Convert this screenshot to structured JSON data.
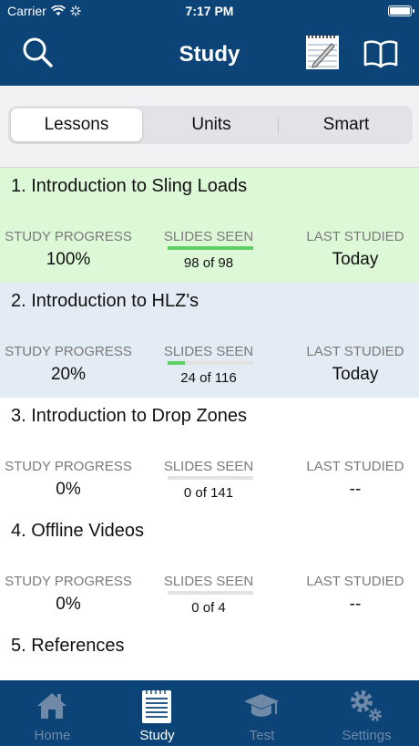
{
  "status_bar": {
    "carrier": "Carrier",
    "time": "7:17 PM"
  },
  "nav": {
    "title": "Study",
    "left_icon": "search-icon",
    "right_icons": [
      "notes-icon",
      "book-icon"
    ]
  },
  "segments": [
    {
      "label": "Lessons",
      "selected": true
    },
    {
      "label": "Units",
      "selected": false
    },
    {
      "label": "Smart",
      "selected": false
    }
  ],
  "labels": {
    "progress": "STUDY PROGRESS",
    "seen": "SLIDES SEEN",
    "last": "LAST STUDIED"
  },
  "lessons": [
    {
      "title": "1. Introduction to Sling Loads",
      "progress": "100%",
      "seen": "98 of 98",
      "seen_fraction": 1.0,
      "last": "Today",
      "bg": "#dcf8d6"
    },
    {
      "title": "2. Introduction to HLZ's",
      "progress": "20%",
      "seen": "24 of 116",
      "seen_fraction": 0.2,
      "last": "Today",
      "bg": "#e3ebf4"
    },
    {
      "title": "3. Introduction to Drop Zones",
      "progress": "0%",
      "seen": "0 of 141",
      "seen_fraction": 0,
      "last": "--",
      "bg": "#ffffff"
    },
    {
      "title": "4. Offline Videos",
      "progress": "0%",
      "seen": "0 of 4",
      "seen_fraction": 0,
      "last": "--",
      "bg": "#ffffff"
    },
    {
      "title": "5. References",
      "bg": "#ffffff"
    }
  ],
  "tabs": [
    {
      "label": "Home",
      "icon": "home-icon",
      "active": false
    },
    {
      "label": "Study",
      "icon": "notepad-icon",
      "active": true
    },
    {
      "label": "Test",
      "icon": "graduation-cap-icon",
      "active": false
    },
    {
      "label": "Settings",
      "icon": "gear-icon",
      "active": false
    }
  ],
  "colors": {
    "brand": "#0c4478",
    "progress_fill": "#5fd068",
    "tab_inactive": "#6f89a6"
  }
}
